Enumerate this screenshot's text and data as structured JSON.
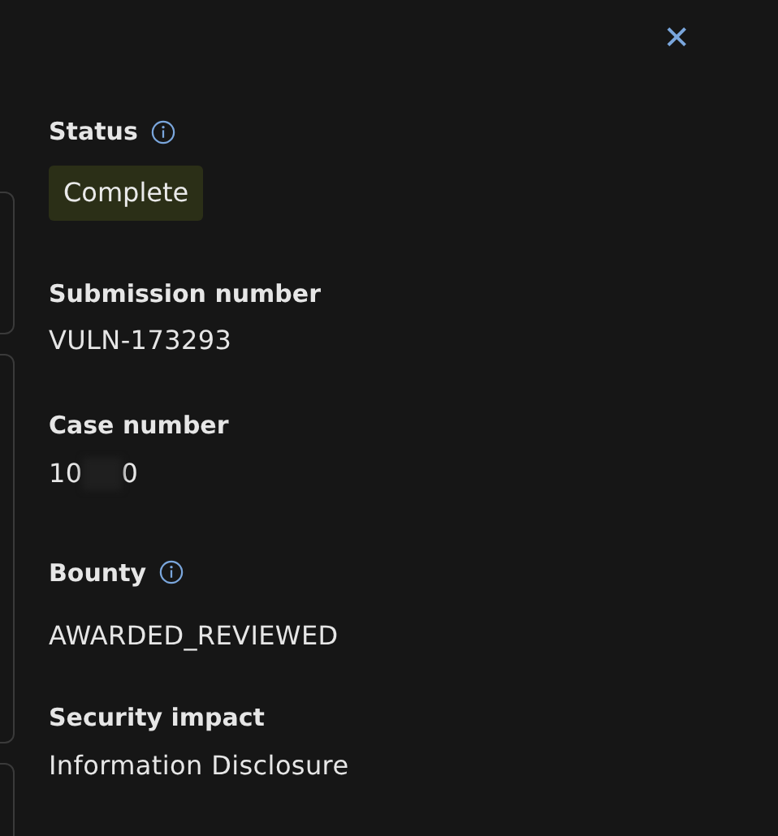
{
  "close_button": {
    "label": "✕"
  },
  "fields": [
    {
      "kind": "badge",
      "label": "Status",
      "info": true,
      "value": "Complete"
    },
    {
      "kind": "text",
      "label": "Submission number",
      "info": false,
      "value": "VULN-173293"
    },
    {
      "kind": "redacted",
      "label": "Case number",
      "info": false,
      "value_start": "10",
      "value_end": "0"
    },
    {
      "kind": "text",
      "label": "Bounty",
      "info": true,
      "value": "AWARDED_REVIEWED"
    },
    {
      "kind": "text",
      "label": "Security impact",
      "info": false,
      "value": "Information Disclosure"
    }
  ]
}
